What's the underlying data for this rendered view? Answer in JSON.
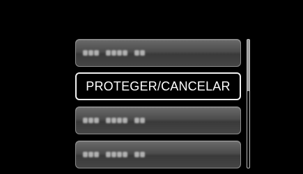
{
  "menu": {
    "items": [
      {
        "label": "",
        "state": "unavailable"
      },
      {
        "label": "PROTEGER/CANCELAR",
        "state": "selected"
      },
      {
        "label": "",
        "state": "unavailable"
      },
      {
        "label": "",
        "state": "unavailable"
      }
    ]
  },
  "scroll": {
    "position_fraction": 0.0,
    "visible_fraction": 0.4
  },
  "colors": {
    "background": "#000000",
    "button_gray": "#4c4c4c",
    "selection_border": "#f2f2f2",
    "text": "#ffffff"
  }
}
